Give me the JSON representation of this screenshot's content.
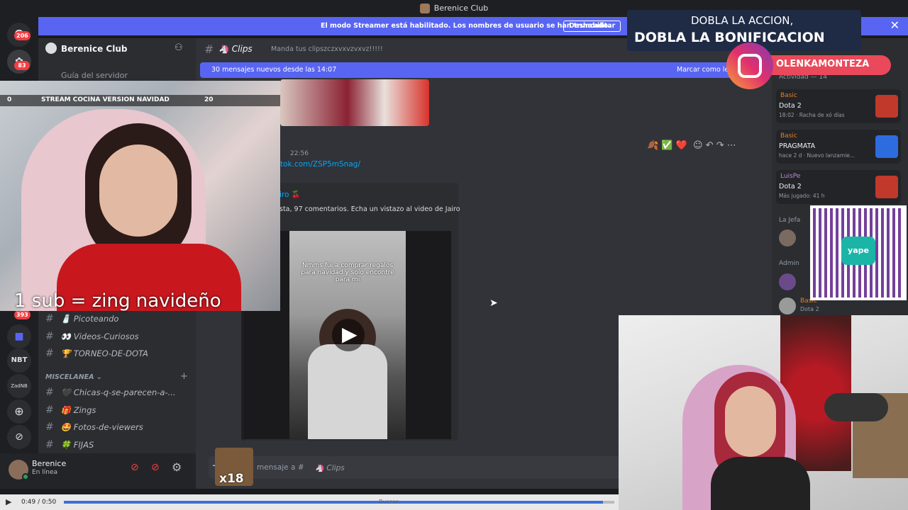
{
  "window": {
    "title": "Berenice Club"
  },
  "rail": {
    "badges": [
      "206",
      "83",
      "393"
    ],
    "items": [
      "NBT",
      "ZadNB"
    ]
  },
  "streamer_bar": {
    "message": "El modo Streamer está habilitado. Los nombres de usuario se han truncado.",
    "button": "Deshabilitar"
  },
  "server": {
    "name": "Berenice Club",
    "guide": "Guía del servidor"
  },
  "channel_header": {
    "name": "Clips",
    "topic": "Manda tus clipszczxvxvzvxvz!!!!!"
  },
  "new_messages": {
    "text": "30 mensajes nuevos desde las 14:07",
    "action": "Marcar como leí"
  },
  "channels": [
    {
      "name": "Picoteando",
      "emoji": "🧂"
    },
    {
      "name": "Videos-Curiosos",
      "emoji": "👀"
    },
    {
      "name": "TORNEO-DE-DOTA",
      "emoji": "🏆"
    }
  ],
  "category": {
    "name": "MISCELANEA"
  },
  "misc_channels": [
    {
      "name": "Chicas-q-se-parecen-a-...",
      "emoji": "🖤"
    },
    {
      "name": "Zings",
      "emoji": "🎁"
    },
    {
      "name": "Fotos-de-viewers",
      "emoji": "🤩"
    },
    {
      "name": "FIJAS",
      "emoji": "🍀"
    }
  ],
  "user_panel": {
    "name": "Berenice",
    "status": "En línea"
  },
  "message": {
    "time": "22:56",
    "link": "tok.com/ZSP5mSnag/",
    "embed_title": "iro 🍒",
    "embed_desc": "sta, 97 comentarios. Echa un vistazo al video de Jairo",
    "video_caption": "Nmms fui a comprar regalos para navidad y solo encontre para mi",
    "reactions": [
      "🍂",
      "✅",
      "❤️"
    ]
  },
  "composer": {
    "placeholder": "mensaje a #",
    "channel": "Clips"
  },
  "members": {
    "section_activity": "Actividad — 14",
    "cards": [
      {
        "tag": "Basic",
        "game": "Dota 2",
        "detail": "18:02 · Racha de xó días",
        "accent": "#c0392b"
      },
      {
        "tag": "Basic",
        "game": "PRAGMATA",
        "detail": "hace 2 d · Nuevo lanzamie...",
        "accent": "#2d6cdf"
      },
      {
        "tag": "LuisPe",
        "game": "Dota 2",
        "detail": "Más jugado: 41 h",
        "accent": "#c0392b"
      }
    ],
    "section_jefa": "La Jefa",
    "section_admin": "Admin",
    "admin_tag": "Basic",
    "admin_game": "Dota 2"
  },
  "overlay": {
    "stream_title": "STREAM COCINA VERSION NAVIDAD",
    "counter_left": "0",
    "counter_right": "20",
    "sub_text": "1 sub = zing navideño",
    "promo_line1": "DOBLA LA ACCION,",
    "promo_line2": "DOBLA LA BONIFICACION",
    "instagram": "OLENKAMONTEZA",
    "qr_label": "yape",
    "sticker": "x18"
  },
  "player": {
    "time": "0:49 / 0:50",
    "progress": 0.98,
    "search": "Buscar"
  },
  "colors": {
    "accent": "#5865f2",
    "badge": "#f23f43",
    "online": "#23a55a"
  }
}
